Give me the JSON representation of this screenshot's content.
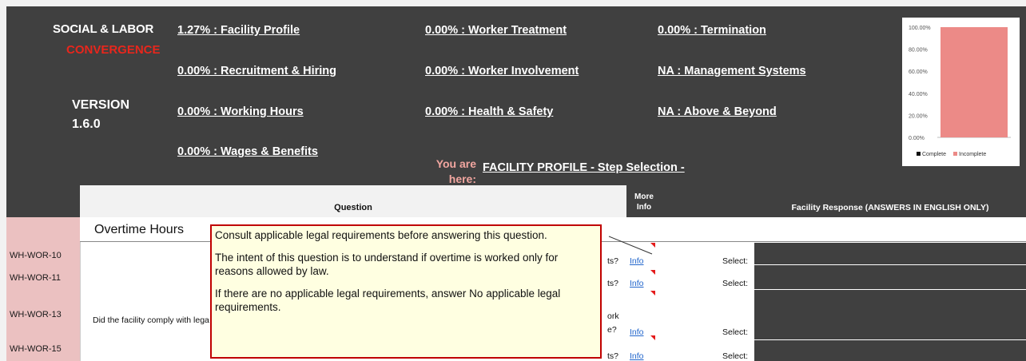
{
  "brand": {
    "line1": "SOCIAL & LABOR",
    "line2": "CONVERGENCE",
    "version": "VERSION 1.6.0"
  },
  "nav": {
    "facility_profile": "1.27% : Facility Profile",
    "recruitment_hiring": "0.00% : Recruitment & Hiring",
    "working_hours": "0.00% : Working Hours",
    "wages_benefits": "0.00% : Wages & Benefits",
    "worker_treatment": "0.00% : Worker Treatment",
    "worker_involvement": "0.00% : Worker Involvement",
    "health_safety": "0.00% : Health & Safety",
    "termination": "0.00% : Termination",
    "management_systems": "NA : Management Systems",
    "above_beyond": "NA : Above & Beyond"
  },
  "location": {
    "label": "You are here:",
    "value": "FACILITY PROFILE - Step Selection -"
  },
  "chart_data": {
    "type": "bar",
    "categories": [
      ""
    ],
    "series": [
      {
        "name": "Complete",
        "values": [
          0
        ],
        "color": "#111111"
      },
      {
        "name": "Incomplete",
        "values": [
          100
        ],
        "color": "#ec8a87"
      }
    ],
    "ylim": [
      0,
      100
    ],
    "ytick_labels": [
      "100.00%",
      "80.00%",
      "60.00%",
      "40.00%",
      "20.00%",
      "0.00%"
    ],
    "legend": "bottom",
    "stacked": true
  },
  "table": {
    "headers": {
      "question": "Question",
      "more_info": "More Info",
      "facility_response": "Facility Response (ANSWERS IN ENGLISH ONLY)"
    },
    "section": "Overtime Hours",
    "question_text": "Did the facility comply with lega",
    "rows": [
      {
        "id": "WH-WOR-10",
        "fragment": "ts?",
        "info": "Info",
        "select": "Select:"
      },
      {
        "id": "WH-WOR-11",
        "fragment": "ts?",
        "info": "Info",
        "select": "Select:"
      },
      {
        "id": "WH-WOR-13",
        "fragment": "ork e?",
        "info": "Info",
        "select": "Select:"
      },
      {
        "id": "WH-WOR-15",
        "fragment": "ts?",
        "info": "Info",
        "select": "Select:"
      }
    ]
  },
  "tooltip": {
    "p1": "Consult applicable legal requirements before answering this question.",
    "p2": "The intent of this question is to understand if overtime is worked only for reasons allowed by law.",
    "p3": "If there are no applicable legal requirements, answer No applicable legal requirements."
  },
  "colors": {
    "header_bg": "#404040",
    "accent_red": "#e8261c",
    "id_column": "#ebc1c1",
    "tooltip_bg": "#ffffe1",
    "tooltip_border": "#c00000"
  }
}
